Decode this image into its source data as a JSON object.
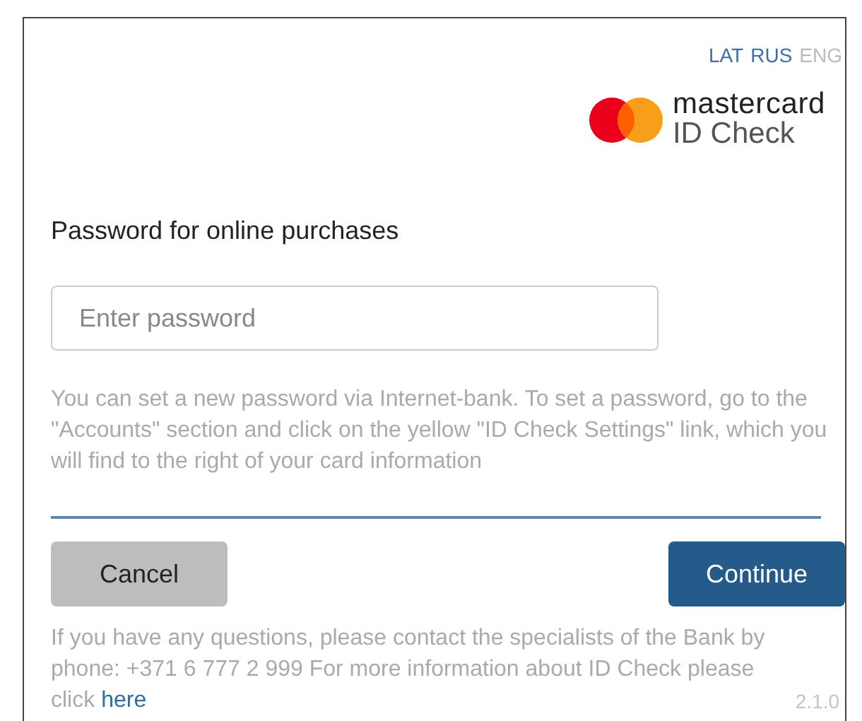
{
  "languages": [
    {
      "label": "LAT",
      "selected": false
    },
    {
      "label": "RUS",
      "selected": false
    },
    {
      "label": "ENG",
      "selected": true
    }
  ],
  "logo": {
    "brand": "mastercard",
    "product": "ID Check"
  },
  "title": "Password for online purchases",
  "password": {
    "placeholder": "Enter password"
  },
  "hint": "You can set a new password via Internet-bank. To set a password, go to the \"Accounts\" section and click on the yellow \"ID Check Settings\" link, which you will find to the right of your card information",
  "buttons": [
    {
      "kind": "secondary",
      "label": "Cancel"
    },
    {
      "kind": "primary",
      "label": "Continue"
    }
  ],
  "help": {
    "text": "If you have any questions, please contact the specialists of the Bank by phone: +371 6 777 2 999 For more information about ID Check please click",
    "link": "here"
  },
  "version": "2.1.0"
}
